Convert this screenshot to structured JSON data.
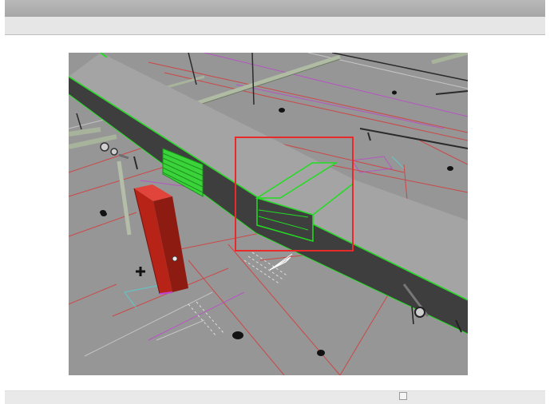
{
  "window": {
    "title": "",
    "colors": {
      "title_bar": "#a9a9a9",
      "tool_bar": "#e6e6e6",
      "status_bar": "#e9e9e9",
      "viewport_background": "#969696"
    }
  },
  "viewport": {
    "view": "3d-perspective",
    "colors": {
      "floor": "#969696",
      "duct_top": "#a4a4a4",
      "duct_side": "#3e3e3e",
      "duct_edge_highlight": "#22dd22",
      "grille": "#3ad43a",
      "red_equipment": "#c8261c",
      "floor_lines_red": "#d63a3a",
      "floor_lines_magenta": "#c040d0",
      "floor_lines_cyan": "#4fd6d6",
      "pipe": "#a6b09c",
      "selection_box": "#e82a2a"
    },
    "icons": [
      "floor-drain-icon",
      "valve-icon",
      "section-marker-icon"
    ]
  }
}
